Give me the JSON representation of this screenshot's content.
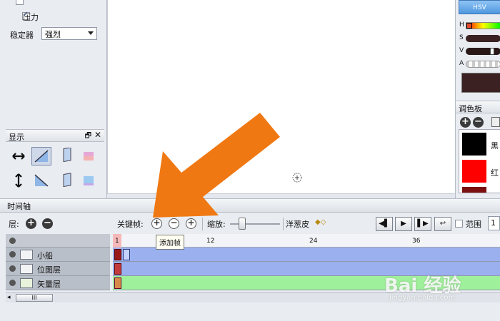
{
  "left_panel": {
    "pressure_label": "压力",
    "stabilizer_label": "稳定器",
    "stabilizer_value": "强烈",
    "display_panel_title": "显示"
  },
  "right_panel": {
    "hsv_button": "HSV",
    "slider_labels": [
      "H",
      "S",
      "V",
      "A"
    ],
    "palette_title": "调色板",
    "swatches": [
      {
        "name": "黑",
        "color": "#000000"
      },
      {
        "name": "红",
        "color": "#ff0000"
      }
    ]
  },
  "timeline": {
    "title": "时间轴",
    "layers_label": "层:",
    "keyframe_label": "关键帧:",
    "zoom_label": "缩放:",
    "onion_label": "洋葱皮",
    "range_label": "范围",
    "range_value": "1",
    "tooltip": "添加帧",
    "ruler_ticks": [
      "1",
      "12",
      "24",
      "36"
    ],
    "layers": [
      {
        "name": "小船",
        "track_color": "#9bb0ef"
      },
      {
        "name": "位图层",
        "track_color": "#9bb0ef"
      },
      {
        "name": "矢量层",
        "track_color": "#9ff09a"
      }
    ],
    "scroll_glyph": "III"
  },
  "watermark": {
    "brand": "Bai 经验",
    "url": "jingyan.baidu.com"
  },
  "colors": {
    "arrow": "#f07812",
    "hue_accent": "#e84a2a"
  }
}
